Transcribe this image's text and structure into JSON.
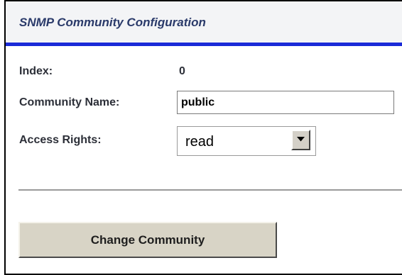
{
  "page": {
    "title": "SNMP Community Configuration"
  },
  "form": {
    "index_label": "Index:",
    "index_value": "0",
    "community_name_label": "Community Name:",
    "community_name_value": "public",
    "access_rights_label": "Access Rights:",
    "access_rights_selected": "read"
  },
  "actions": {
    "change_button_label": "Change Community"
  },
  "colors": {
    "header_rule": "#1a2ad8",
    "header_background": "#f3f4f6",
    "header_text": "#2a3a6a",
    "button_face": "#d8d4c6"
  },
  "icons": {
    "dropdown": "chevron-down-icon"
  }
}
